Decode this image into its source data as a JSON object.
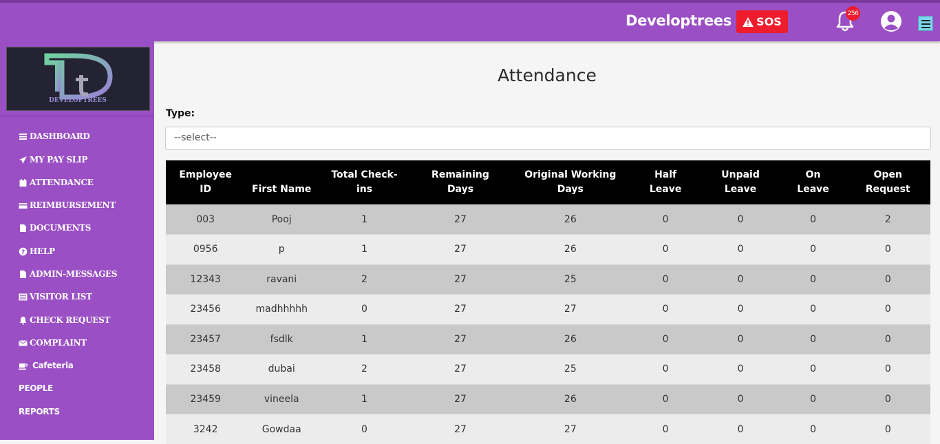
{
  "header": {
    "brand": "Developtrees",
    "sos_label": "SOS",
    "notification_count": "256"
  },
  "sidebar": {
    "logo_text": "DEVELOPTREES",
    "items": [
      {
        "label": "DASHBOARD",
        "icon": "bars-icon"
      },
      {
        "label": "MY PAY SLIP",
        "icon": "paper-plane-icon"
      },
      {
        "label": "ATTENDANCE",
        "icon": "calendar-icon"
      },
      {
        "label": "REIMBURSEMENT",
        "icon": "credit-card-icon"
      },
      {
        "label": "DOCUMENTS",
        "icon": "file-icon"
      },
      {
        "label": "HELP",
        "icon": "question-icon"
      },
      {
        "label": "ADMIN-MESSAGES",
        "icon": "file-icon"
      },
      {
        "label": "VISITOR LIST",
        "icon": "list-icon"
      },
      {
        "label": "CHECK REQUEST",
        "icon": "bell-icon"
      },
      {
        "label": "COMPLAINT",
        "icon": "envelope-icon"
      },
      {
        "label": "Cafeteria",
        "icon": "coffee-icon"
      },
      {
        "label": "PEOPLE",
        "icon": ""
      },
      {
        "label": "REPORTS",
        "icon": ""
      }
    ]
  },
  "main": {
    "title": "Attendance",
    "type_label": "Type:",
    "select_value": "--select--"
  },
  "table": {
    "headers": [
      [
        "Employee",
        "ID"
      ],
      [
        "First Name"
      ],
      [
        "Total Check-",
        "ins"
      ],
      [
        "Remaining",
        "Days"
      ],
      [
        "Original Working",
        "Days"
      ],
      [
        "Half",
        "Leave"
      ],
      [
        "Unpaid",
        "Leave"
      ],
      [
        "On",
        "Leave"
      ],
      [
        "Open",
        "Request"
      ]
    ],
    "rows": [
      [
        "003",
        "Pooj",
        "1",
        "27",
        "26",
        "0",
        "0",
        "0",
        "2"
      ],
      [
        "0956",
        "p",
        "1",
        "27",
        "26",
        "0",
        "0",
        "0",
        "0"
      ],
      [
        "12343",
        "ravani",
        "2",
        "27",
        "25",
        "0",
        "0",
        "0",
        "0"
      ],
      [
        "23456",
        "madhhhhh",
        "0",
        "27",
        "27",
        "0",
        "0",
        "0",
        "0"
      ],
      [
        "23457",
        "fsdlk",
        "1",
        "27",
        "26",
        "0",
        "0",
        "0",
        "0"
      ],
      [
        "23458",
        "dubai",
        "2",
        "27",
        "25",
        "0",
        "0",
        "0",
        "0"
      ],
      [
        "23459",
        "vineela",
        "1",
        "27",
        "26",
        "0",
        "0",
        "0",
        "0"
      ],
      [
        "3242",
        "Gowdaa",
        "0",
        "27",
        "27",
        "0",
        "0",
        "0",
        "0"
      ]
    ]
  },
  "colors": {
    "brand_purple": "#9a4fc4",
    "sos_red": "#ee1c2c",
    "table_header": "#000000"
  }
}
